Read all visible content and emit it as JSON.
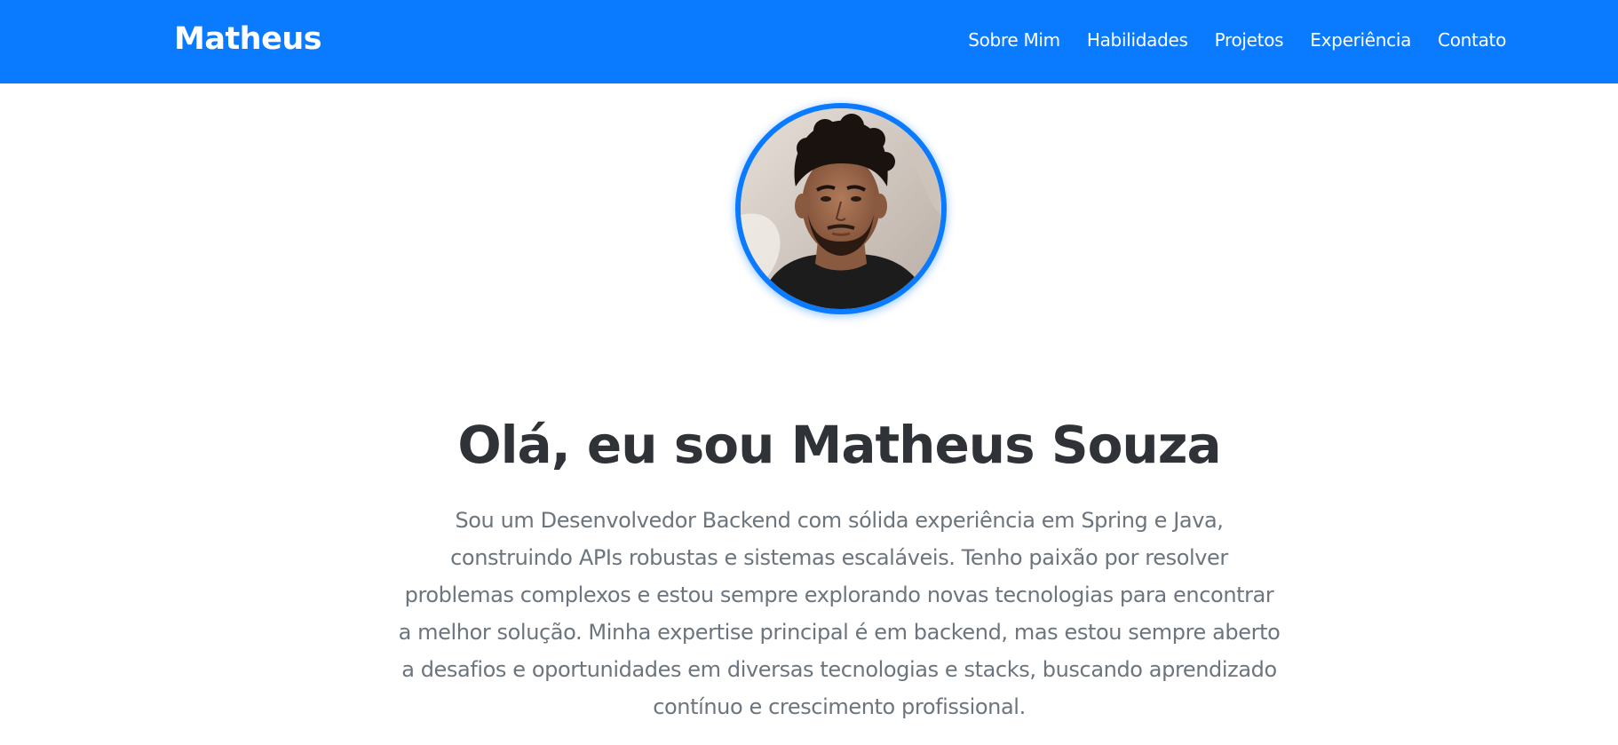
{
  "navbar": {
    "brand": "Matheus",
    "links": [
      "Sobre Mim",
      "Habilidades",
      "Projetos",
      "Experiência",
      "Contato"
    ],
    "background_color": "#0a7bff"
  },
  "hero": {
    "title": "Olá, eu sou Matheus Souza",
    "description": "Sou um Desenvolvedor Backend com sólida experiência em Spring e Java, construindo APIs robustas e sistemas escaláveis. Tenho paixão por resolver problemas complexos e estou sempre explorando novas tecnologias para encontrar a melhor solução. Minha expertise principal é em backend, mas estou sempre aberto a desafios e oportunidades em diversas tecnologias e stacks, buscando aprendizado contínuo e crescimento profissional."
  },
  "colors": {
    "accent": "#0a7bff",
    "title": "#2f3338",
    "text": "#6c757d"
  }
}
